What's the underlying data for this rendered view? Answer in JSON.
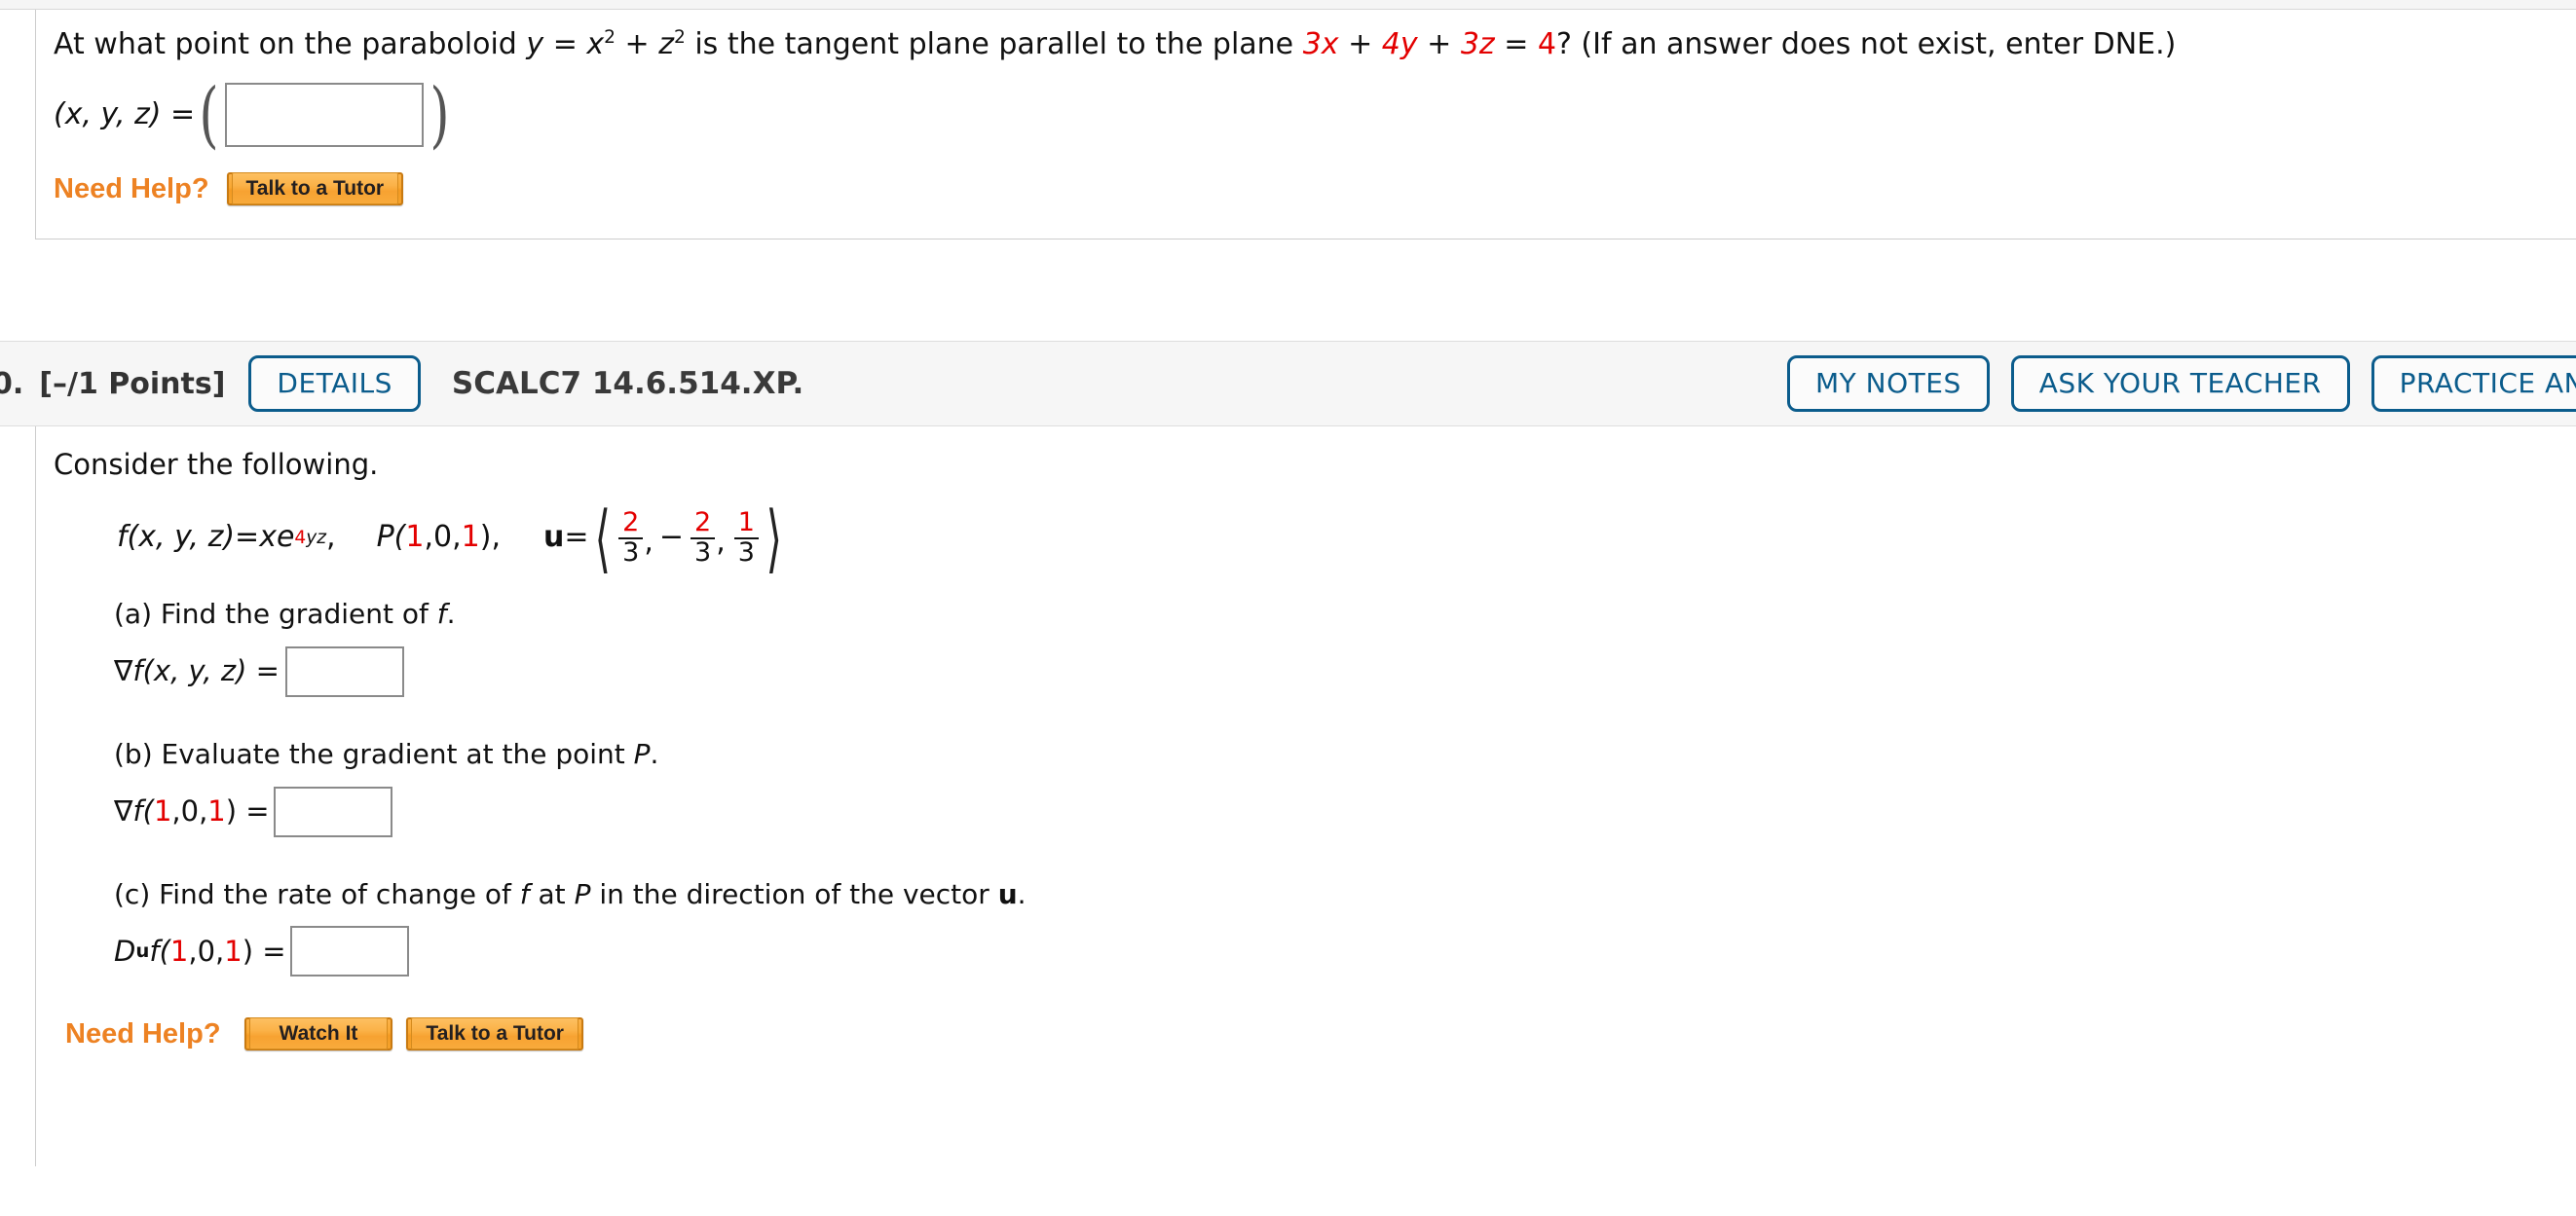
{
  "question1": {
    "prompt_pre": "At what point on the paraboloid ",
    "equation_y": "y",
    "eq_eq": " = ",
    "eq_x": "x",
    "eq_exp1": "2",
    "eq_plus": " + ",
    "eq_z": "z",
    "eq_exp2": "2",
    "prompt_mid": " is the tangent plane parallel to the plane ",
    "plane_3x": "3x",
    "plane_plus1": " + ",
    "plane_4y": "4y",
    "plane_plus2": " + ",
    "plane_3z": "3z",
    "plane_eq": " = ",
    "plane_4": "4",
    "prompt_post": "?  (If an answer does not exist, enter DNE.)",
    "answer_label": "(x, y, z) = ",
    "answer_value": "",
    "open_paren": "(",
    "close_paren": ")",
    "need_help_label": "Need Help?",
    "buttons": [
      {
        "label": "Talk to a Tutor"
      }
    ]
  },
  "question2": {
    "number": "0.",
    "points": "[–/1 Points]",
    "details_label": "DETAILS",
    "code": "SCALC7 14.6.514.XP.",
    "header_buttons": [
      {
        "label": "MY NOTES"
      },
      {
        "label": "ASK YOUR TEACHER"
      },
      {
        "label": "PRACTICE ANOTHER"
      }
    ],
    "intro": "Consider the following.",
    "function": {
      "f_label": "f(x, y, z)",
      "equals": " = ",
      "xe": "xe",
      "exp_red": "4",
      "exp_black": "yz",
      "comma": ",",
      "point_label": "P(",
      "point_1a": "1",
      "point_sep1": ", ",
      "point_0": "0",
      "point_sep2": ", ",
      "point_1b": "1",
      "point_close": "),",
      "u_label": "u",
      "u_equals": " = ",
      "vector": [
        {
          "num": "2",
          "den": "3",
          "sign": ""
        },
        {
          "num": "2",
          "den": "3",
          "sign": "−"
        },
        {
          "num": "1",
          "den": "3",
          "sign": ""
        }
      ]
    },
    "parts": [
      {
        "prompt_a": "(a) Find the gradient of ",
        "prompt_b": "f",
        "prompt_c": ".",
        "answer_label_pre": "∇f(x, y, z) = ",
        "answer_value": ""
      },
      {
        "prompt_a": "(b) Evaluate the gradient at the point ",
        "prompt_b": "P",
        "prompt_c": ".",
        "answer_label_pre": "∇f(",
        "answer_value": ""
      },
      {
        "prompt_a": "(c) Find the rate of change of ",
        "prompt_b": "f",
        "prompt_c": " at ",
        "prompt_d": "P",
        "prompt_e": " in the direction of the vector ",
        "prompt_f": "u",
        "prompt_g": ".",
        "answer_value": ""
      }
    ],
    "part_b_label": {
      "grad": "∇f(",
      "one_a": "1",
      "sep1": ", ",
      "zero": "0",
      "sep2": ", ",
      "one_b": "1",
      "close": ") = "
    },
    "part_c_label": {
      "d": "D",
      "u": "u",
      "f": "f(",
      "one_a": "1",
      "sep1": ", ",
      "zero": "0",
      "sep2": ", ",
      "one_b": "1",
      "close": ") = "
    },
    "need_help_label": "Need Help?",
    "buttons": [
      {
        "label": "Watch It"
      },
      {
        "label": "Talk to a Tutor"
      }
    ]
  },
  "colors": {
    "accent_blue": "#0b5c8c",
    "orange": "#ed8223",
    "red": "#e30000",
    "header_bg": "#f6f6f6",
    "border": "#cdcdcd"
  }
}
